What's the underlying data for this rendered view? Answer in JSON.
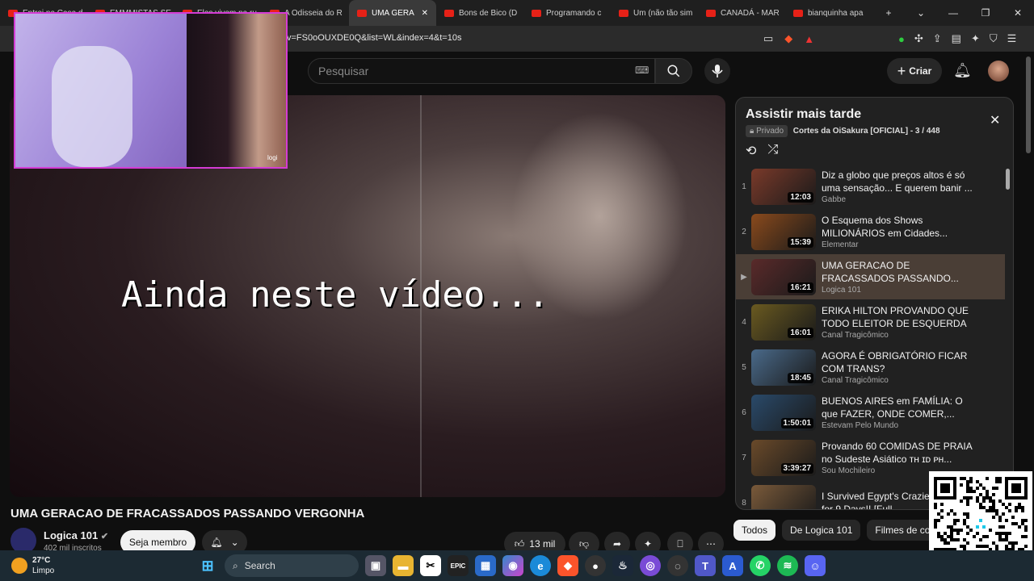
{
  "browser": {
    "tabs": [
      {
        "label": "Entrei na Casa d",
        "active": false
      },
      {
        "label": "EMMMISTAS SE",
        "active": false
      },
      {
        "label": "Eles vivem na ru",
        "active": false
      },
      {
        "label": "A Odisseia do R",
        "active": false
      },
      {
        "label": "UMA GERA",
        "active": true
      },
      {
        "label": "Bons de Bico (D",
        "active": false
      },
      {
        "label": "Programando c",
        "active": false
      },
      {
        "label": "Um (não tão sim",
        "active": false
      },
      {
        "label": "CANADÁ - MAR",
        "active": false
      },
      {
        "label": "bianquinha apa",
        "active": false
      }
    ],
    "url": "v=FS0oOUXDE0Q&list=WL&index=4&t=10s"
  },
  "youtube": {
    "search_placeholder": "Pesquisar",
    "create_label": "Criar"
  },
  "video": {
    "overlay_text": "Ainda neste vídeo...",
    "title": "UMA GERACAO DE FRACASSADOS PASSANDO VERGONHA",
    "channel": "Logica 101",
    "subscribers": "402 mil inscritos",
    "join_label": "Seja membro",
    "likes": "13 mil",
    "cam_label": "logi"
  },
  "playlist": {
    "title": "Assistir mais tarde",
    "privacy": "Privado",
    "owner_progress": "Cortes da OiSakura [OFICIAL] - 3 / 448",
    "items": [
      {
        "index": "1",
        "title": "Diz a globo que preços altos é só uma sensação... E querem banir ...",
        "channel": "Gabbe",
        "duration": "12:03",
        "color": "#7a3a2a"
      },
      {
        "index": "2",
        "title": "O Esquema dos Shows MILIONÁRIOS em Cidades...",
        "channel": "Elementar",
        "duration": "15:39",
        "color": "#8a4a1c"
      },
      {
        "index": "▶",
        "title": "UMA GERACAO DE FRACASSADOS PASSANDO...",
        "channel": "Logica 101",
        "duration": "16:21",
        "color": "#5a2a2a",
        "current": true
      },
      {
        "index": "4",
        "title": "ERIKA HILTON PROVANDO QUE TODO ELEITOR DE ESQUERDA ...",
        "channel": "Canal Tragicômico",
        "duration": "16:01",
        "color": "#6a5a20"
      },
      {
        "index": "5",
        "title": "AGORA É OBRIGATÓRIO FICAR COM TRANS?",
        "channel": "Canal Tragicômico",
        "duration": "18:45",
        "color": "#4a6a8a"
      },
      {
        "index": "6",
        "title": "BUENOS AIRES em FAMÍLIA: O que FAZER, ONDE COMER,...",
        "channel": "Estevam Pelo Mundo",
        "duration": "1:50:01",
        "color": "#2a4a6a"
      },
      {
        "index": "7",
        "title": "Provando 60 COMIDAS DE PRAIA no Sudeste Asiático ᴛʜ ɪᴅ ᴘʜ...",
        "channel": "Sou Mochileiro",
        "duration": "3:39:27",
        "color": "#6a4a2a"
      },
      {
        "index": "8",
        "title": "I Survived Egypt's Craziest Food for 9 Days!! [Full...",
        "channel": "",
        "duration": "",
        "color": "#7a5a3a"
      }
    ]
  },
  "chips": [
    "Todos",
    "De Logica 101",
    "Filmes de com"
  ],
  "taskbar": {
    "weather_temp": "27°C",
    "weather_desc": "Limpo",
    "search_label": "Search"
  }
}
